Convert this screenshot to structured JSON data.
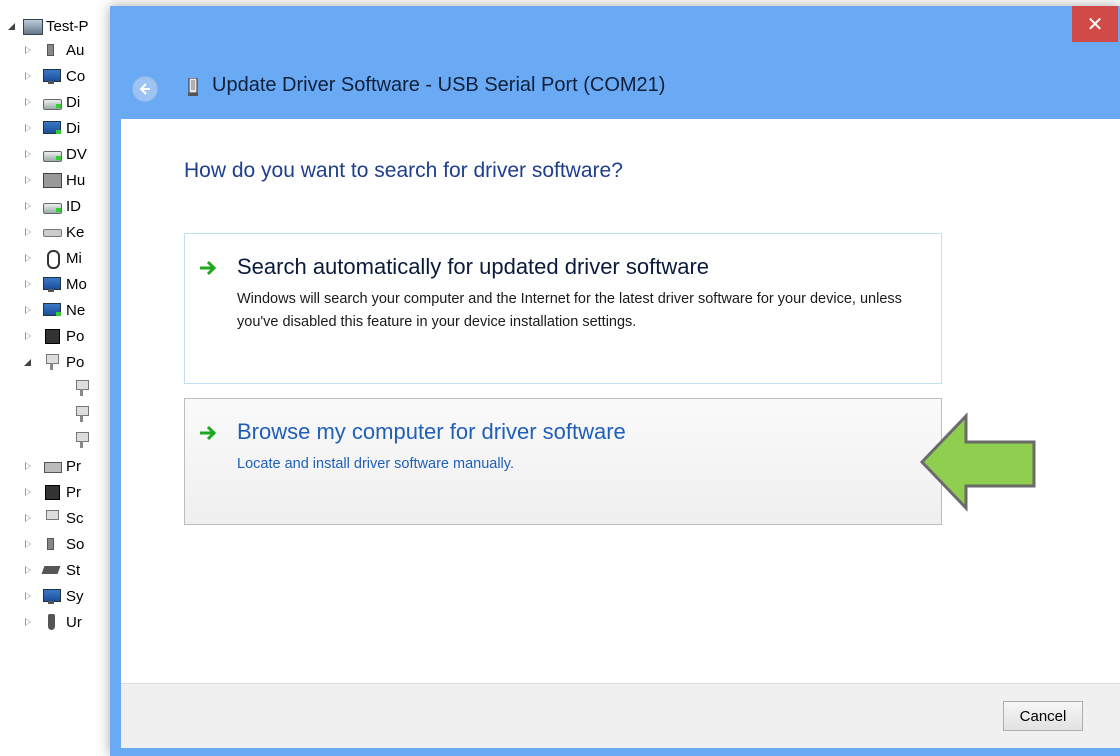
{
  "tree": {
    "root_label": "Test-P",
    "items": [
      {
        "label": "Au",
        "icon": "speaker-icon",
        "expanded": false
      },
      {
        "label": "Co",
        "icon": "computer-icon",
        "expanded": false
      },
      {
        "label": "Di",
        "icon": "disk-drive-icon",
        "expanded": false
      },
      {
        "label": "Di",
        "icon": "display-adapter-icon",
        "expanded": false
      },
      {
        "label": "DV",
        "icon": "dvd-drive-icon",
        "expanded": false
      },
      {
        "label": "Hu",
        "icon": "hid-icon",
        "expanded": false
      },
      {
        "label": "ID",
        "icon": "ide-controller-icon",
        "expanded": false
      },
      {
        "label": "Ke",
        "icon": "keyboard-icon",
        "expanded": false
      },
      {
        "label": "Mi",
        "icon": "mouse-icon",
        "expanded": false
      },
      {
        "label": "Mo",
        "icon": "monitor-icon",
        "expanded": false
      },
      {
        "label": "Ne",
        "icon": "network-adapter-icon",
        "expanded": false
      },
      {
        "label": "Po",
        "icon": "portable-device-icon",
        "expanded": false
      },
      {
        "label": "Po",
        "icon": "port-icon",
        "expanded": true
      },
      {
        "label": "",
        "icon": "port-icon",
        "child": true
      },
      {
        "label": "",
        "icon": "port-icon",
        "child": true
      },
      {
        "label": "",
        "icon": "port-icon",
        "child": true
      },
      {
        "label": "Pr",
        "icon": "printer-icon",
        "expanded": false
      },
      {
        "label": "Pr",
        "icon": "processor-icon",
        "expanded": false
      },
      {
        "label": "Sc",
        "icon": "software-device-icon",
        "expanded": false
      },
      {
        "label": "So",
        "icon": "sound-icon",
        "expanded": false
      },
      {
        "label": "St",
        "icon": "storage-controller-icon",
        "expanded": false
      },
      {
        "label": "Sy",
        "icon": "system-device-icon",
        "expanded": false
      },
      {
        "label": "Ur",
        "icon": "usb-icon",
        "expanded": false
      }
    ]
  },
  "dialog": {
    "close_label": "✕",
    "title": "Update Driver Software - USB Serial Port (COM21)",
    "question": "How do you want to search for driver software?",
    "options": [
      {
        "title": "Search automatically for updated driver software",
        "description": "Windows will search your computer and the Internet for the latest driver software for your device, unless you've disabled this feature in your device installation settings."
      },
      {
        "title": "Browse my computer for driver software",
        "description": "Locate and install driver software manually."
      }
    ],
    "cancel_label": "Cancel"
  },
  "colors": {
    "dialog_frame": "#6aaaf5",
    "close_button": "#d04a47",
    "question_text": "#1e3e8e",
    "link_text": "#1f5fb8",
    "annotation_arrow": "#8fce4e"
  }
}
